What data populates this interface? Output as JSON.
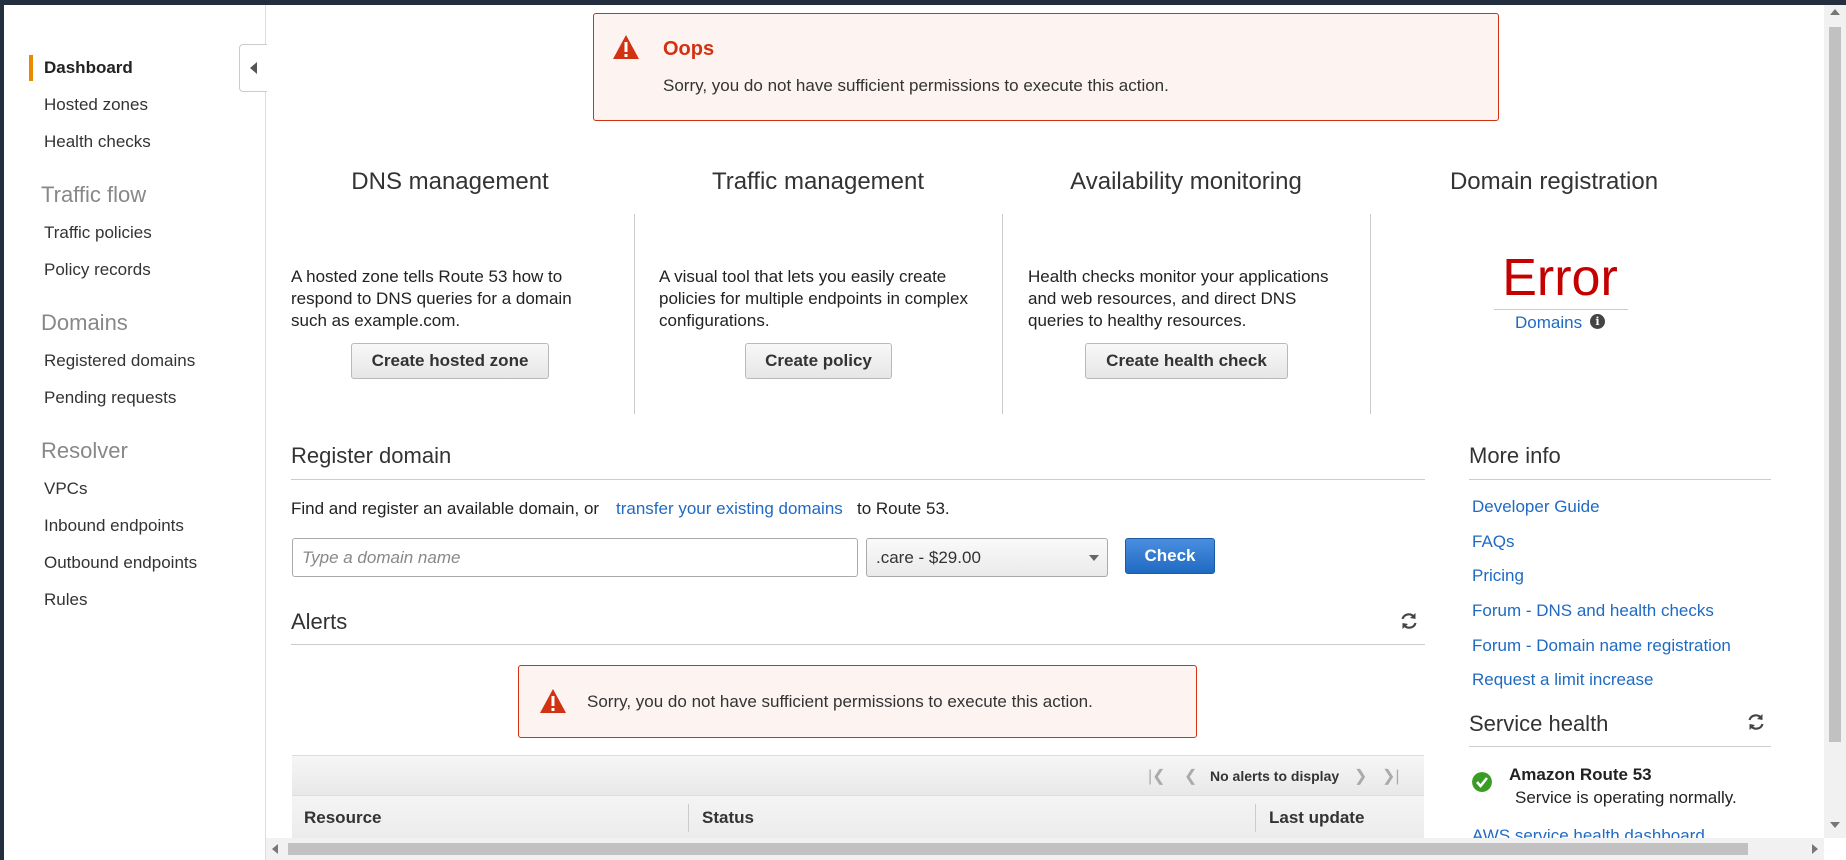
{
  "sidebar": {
    "items": [
      {
        "label": "Dashboard"
      },
      {
        "label": "Hosted zones"
      },
      {
        "label": "Health checks"
      },
      {
        "heading": "Traffic flow"
      },
      {
        "label": "Traffic policies"
      },
      {
        "label": "Policy records"
      },
      {
        "heading": "Domains"
      },
      {
        "label": "Registered domains"
      },
      {
        "label": "Pending requests"
      },
      {
        "heading": "Resolver"
      },
      {
        "label": "VPCs"
      },
      {
        "label": "Inbound endpoints"
      },
      {
        "label": "Outbound endpoints"
      },
      {
        "label": "Rules"
      }
    ]
  },
  "banner": {
    "title": "Oops",
    "message": "Sorry, you do not have sufficient permissions to execute this action."
  },
  "features": {
    "dns": {
      "title": "DNS management",
      "description": "A hosted zone tells Route 53 how to respond to DNS queries for a domain such as example.com.",
      "button": "Create hosted zone"
    },
    "traffic": {
      "title": "Traffic management",
      "description": "A visual tool that lets you easily create policies for multiple endpoints in complex configurations.",
      "button": "Create policy"
    },
    "availability": {
      "title": "Availability monitoring",
      "description": "Health checks monitor your applications and web resources, and direct DNS queries to healthy resources.",
      "button": "Create health check"
    },
    "domain": {
      "title": "Domain registration",
      "error": "Error",
      "link": "Domains"
    }
  },
  "register": {
    "title": "Register domain",
    "text_before": "Find and register an available domain, or",
    "link": "transfer your existing domains",
    "text_after": "to Route 53.",
    "input_placeholder": "Type a domain name",
    "tld_selected": ".care - $29.00",
    "check_button": "Check"
  },
  "alerts": {
    "title": "Alerts",
    "message": "Sorry, you do not have sufficient permissions to execute this action.",
    "pager_text": "No alerts to display",
    "columns": [
      "Resource",
      "Status",
      "Last update"
    ]
  },
  "more_info": {
    "title": "More info",
    "links": [
      "Developer Guide",
      "FAQs",
      "Pricing",
      "Forum - DNS and health checks",
      "Forum - Domain name registration",
      "Request a limit increase"
    ]
  },
  "service_health": {
    "title": "Service health",
    "service_name": "Amazon Route 53",
    "status": "Service is operating normally.",
    "dashboard_link": "AWS service health dashboard"
  },
  "colors": {
    "accent": "#e88a00",
    "error": "#d13212",
    "link": "#1f6ac2",
    "primary_button": "#1f6ac2",
    "ok": "#3a9d23"
  },
  "icons": [
    "collapse-chevron-icon",
    "warning-icon",
    "info-icon",
    "refresh-icon",
    "first-page-icon",
    "prev-page-icon",
    "next-page-icon",
    "last-page-icon",
    "check-circle-icon"
  ]
}
